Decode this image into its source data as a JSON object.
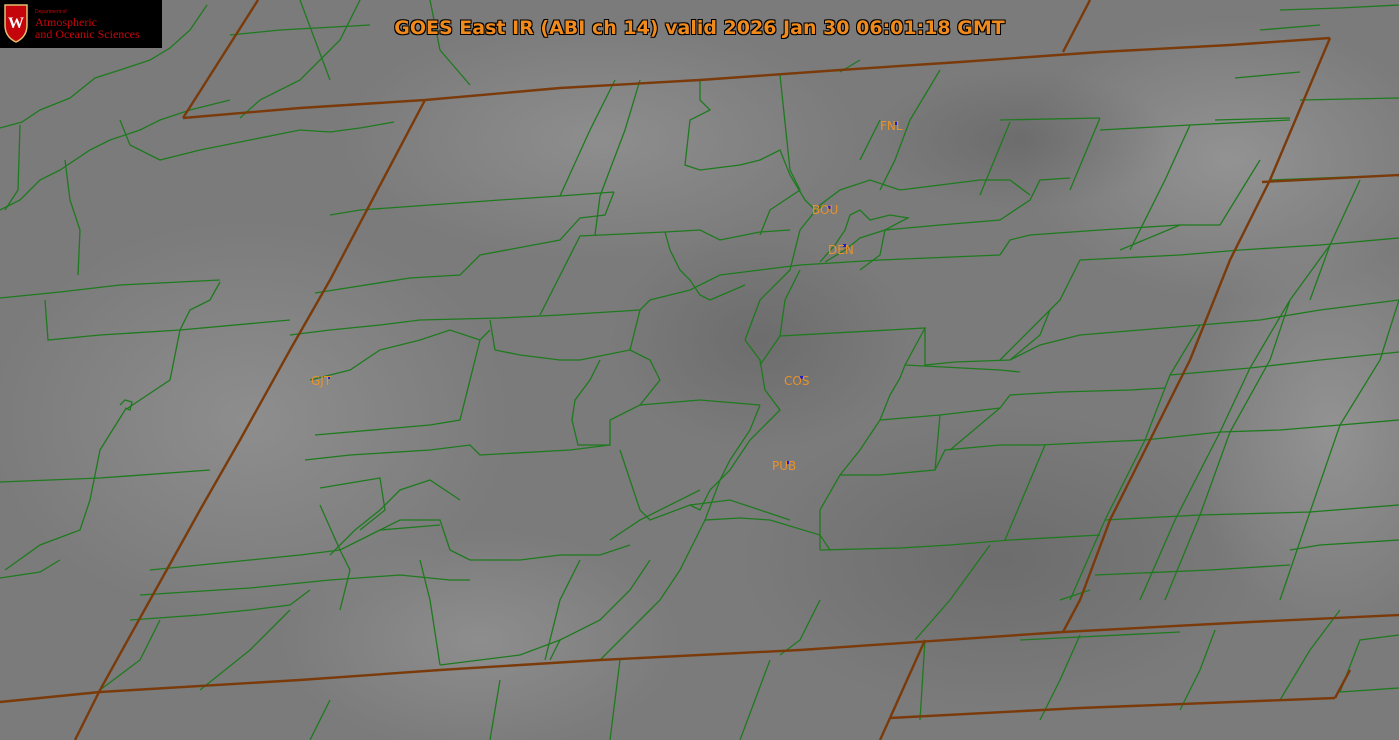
{
  "title": "GOES East IR (ABI ch 14) valid 2026 Jan 30 06:01:18 GMT",
  "logo": {
    "small_text": "Department of",
    "line1": "Atmospheric",
    "line2": "and Oceanic Sciences",
    "crest_letter": "W"
  },
  "colors": {
    "county_lines": "#1e7a1e",
    "state_lines": "#7a3a0a",
    "station_labels": "#e8922a",
    "station_markers": "#1b1bd6",
    "title": "#f08a1c",
    "background": "#7a7a7a"
  },
  "stations": [
    {
      "id": "FNL",
      "label": "FNL"
    },
    {
      "id": "BOU",
      "label": "BOU"
    },
    {
      "id": "DEN",
      "label": "DEN"
    },
    {
      "id": "GJT",
      "label": "GJT"
    },
    {
      "id": "COS",
      "label": "COS"
    },
    {
      "id": "PUB",
      "label": "PUB"
    }
  ]
}
